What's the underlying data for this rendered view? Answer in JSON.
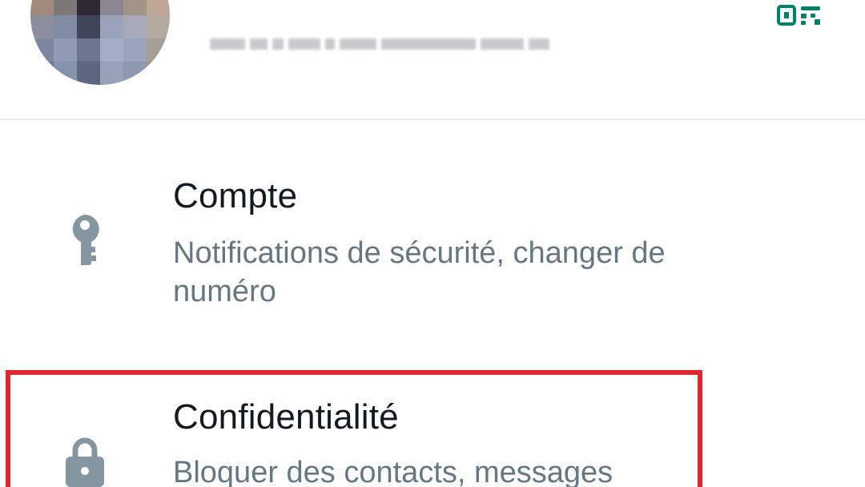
{
  "profile": {
    "name_redacted": true
  },
  "icons": {
    "qr_code": "qr-code-icon",
    "account": "key-icon",
    "privacy": "lock-icon"
  },
  "colors": {
    "accent": "#008069",
    "title_text": "#111b21",
    "subtitle_text": "#667781",
    "icon_gray": "#8696a0",
    "highlight": "#e0262f"
  },
  "settings": {
    "items": [
      {
        "title": "Compte",
        "subtitle": "Notifications de sécurité, changer de numéro",
        "icon": "key-icon"
      },
      {
        "title": "Confidentialité",
        "subtitle": "Bloquer des contacts, messages",
        "icon": "lock-icon",
        "highlighted": true
      }
    ]
  }
}
